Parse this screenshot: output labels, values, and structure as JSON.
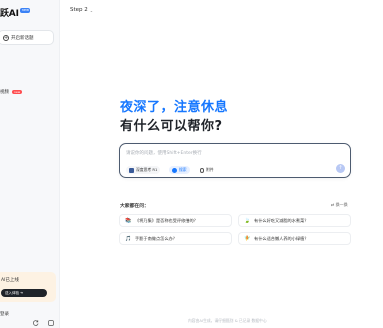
{
  "sidebar": {
    "brand": "跃AI",
    "brand_tag": "new",
    "new_chat_label": "开启新话题",
    "item_label": "视频",
    "item_badge": "new",
    "promo_text": "AI已上线",
    "promo_button": "送入体验 ➜",
    "footer_label": "登录"
  },
  "header": {
    "step_label": "Step 2",
    "step_chevron": "⌄"
  },
  "hero": {
    "line1": "夜深了，注意休息",
    "line2": "有什么可以帮你?"
  },
  "input": {
    "placeholder": "请说你的问题，使用Shift+Enter换行",
    "tools": [
      {
        "label": "深度思考 R1",
        "icon": "deep-think-icon"
      },
      {
        "label": "搜索",
        "icon": "search-icon"
      },
      {
        "label": "附件",
        "icon": "attachment-icon"
      }
    ],
    "send_icon": "↑"
  },
  "suggestions": {
    "title": "大家都在问：",
    "refresh_label": "⇄ 换一换",
    "items": [
      {
        "emoji": "📚",
        "label": "《将乃集》是否称也受评修缮的？"
      },
      {
        "emoji": "🍃",
        "label": "有什么好吃又减脂的水煮菜？"
      },
      {
        "emoji": "🎵",
        "label": "手影于南做点怎么办？"
      },
      {
        "emoji": "🧚",
        "label": "有什么适合懒人养的小绿植？"
      }
    ]
  },
  "footer": {
    "note": "内容由AI生成，请仔细甄别    & 已记录 数据中心"
  },
  "colors": {
    "accent": "#1677ff",
    "promo_bg": "#fdf2e3",
    "badge": "#ff4d4f"
  }
}
